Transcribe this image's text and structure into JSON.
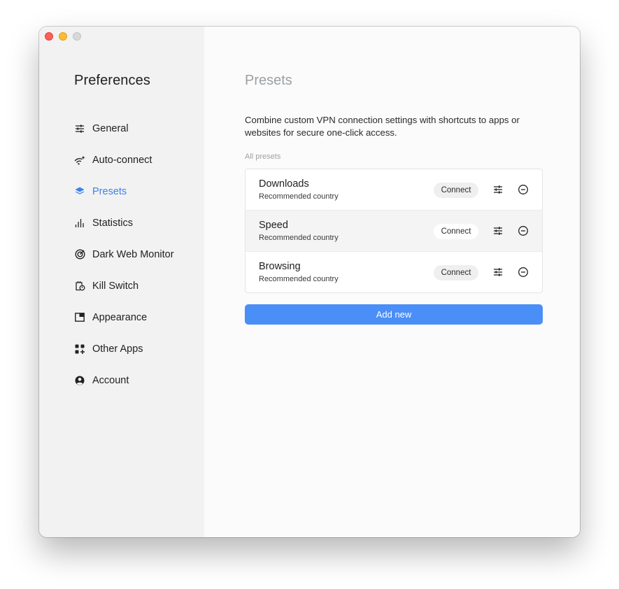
{
  "sidebar": {
    "title": "Preferences",
    "items": [
      {
        "label": "General",
        "icon": "sliders-icon"
      },
      {
        "label": "Auto-connect",
        "icon": "wifi-sparkle-icon"
      },
      {
        "label": "Presets",
        "icon": "layers-icon",
        "active": true
      },
      {
        "label": "Statistics",
        "icon": "bar-chart-icon"
      },
      {
        "label": "Dark Web Monitor",
        "icon": "target-icon"
      },
      {
        "label": "Kill Switch",
        "icon": "kill-switch-icon"
      },
      {
        "label": "Appearance",
        "icon": "window-icon"
      },
      {
        "label": "Other Apps",
        "icon": "apps-grid-icon"
      },
      {
        "label": "Account",
        "icon": "user-circle-icon"
      }
    ]
  },
  "main": {
    "title": "Presets",
    "description": "Combine custom VPN connection settings with shortcuts to apps or websites for secure one-click access.",
    "section_label": "All presets",
    "presets": [
      {
        "name": "Downloads",
        "subtitle": "Recommended country",
        "connect_label": "Connect"
      },
      {
        "name": "Speed",
        "subtitle": "Recommended country",
        "connect_label": "Connect"
      },
      {
        "name": "Browsing",
        "subtitle": "Recommended country",
        "connect_label": "Connect"
      }
    ],
    "add_label": "Add new"
  },
  "colors": {
    "accent": "#3a82ef",
    "button": "#4a8ef8",
    "sidebar_bg": "#f2f2f2"
  }
}
